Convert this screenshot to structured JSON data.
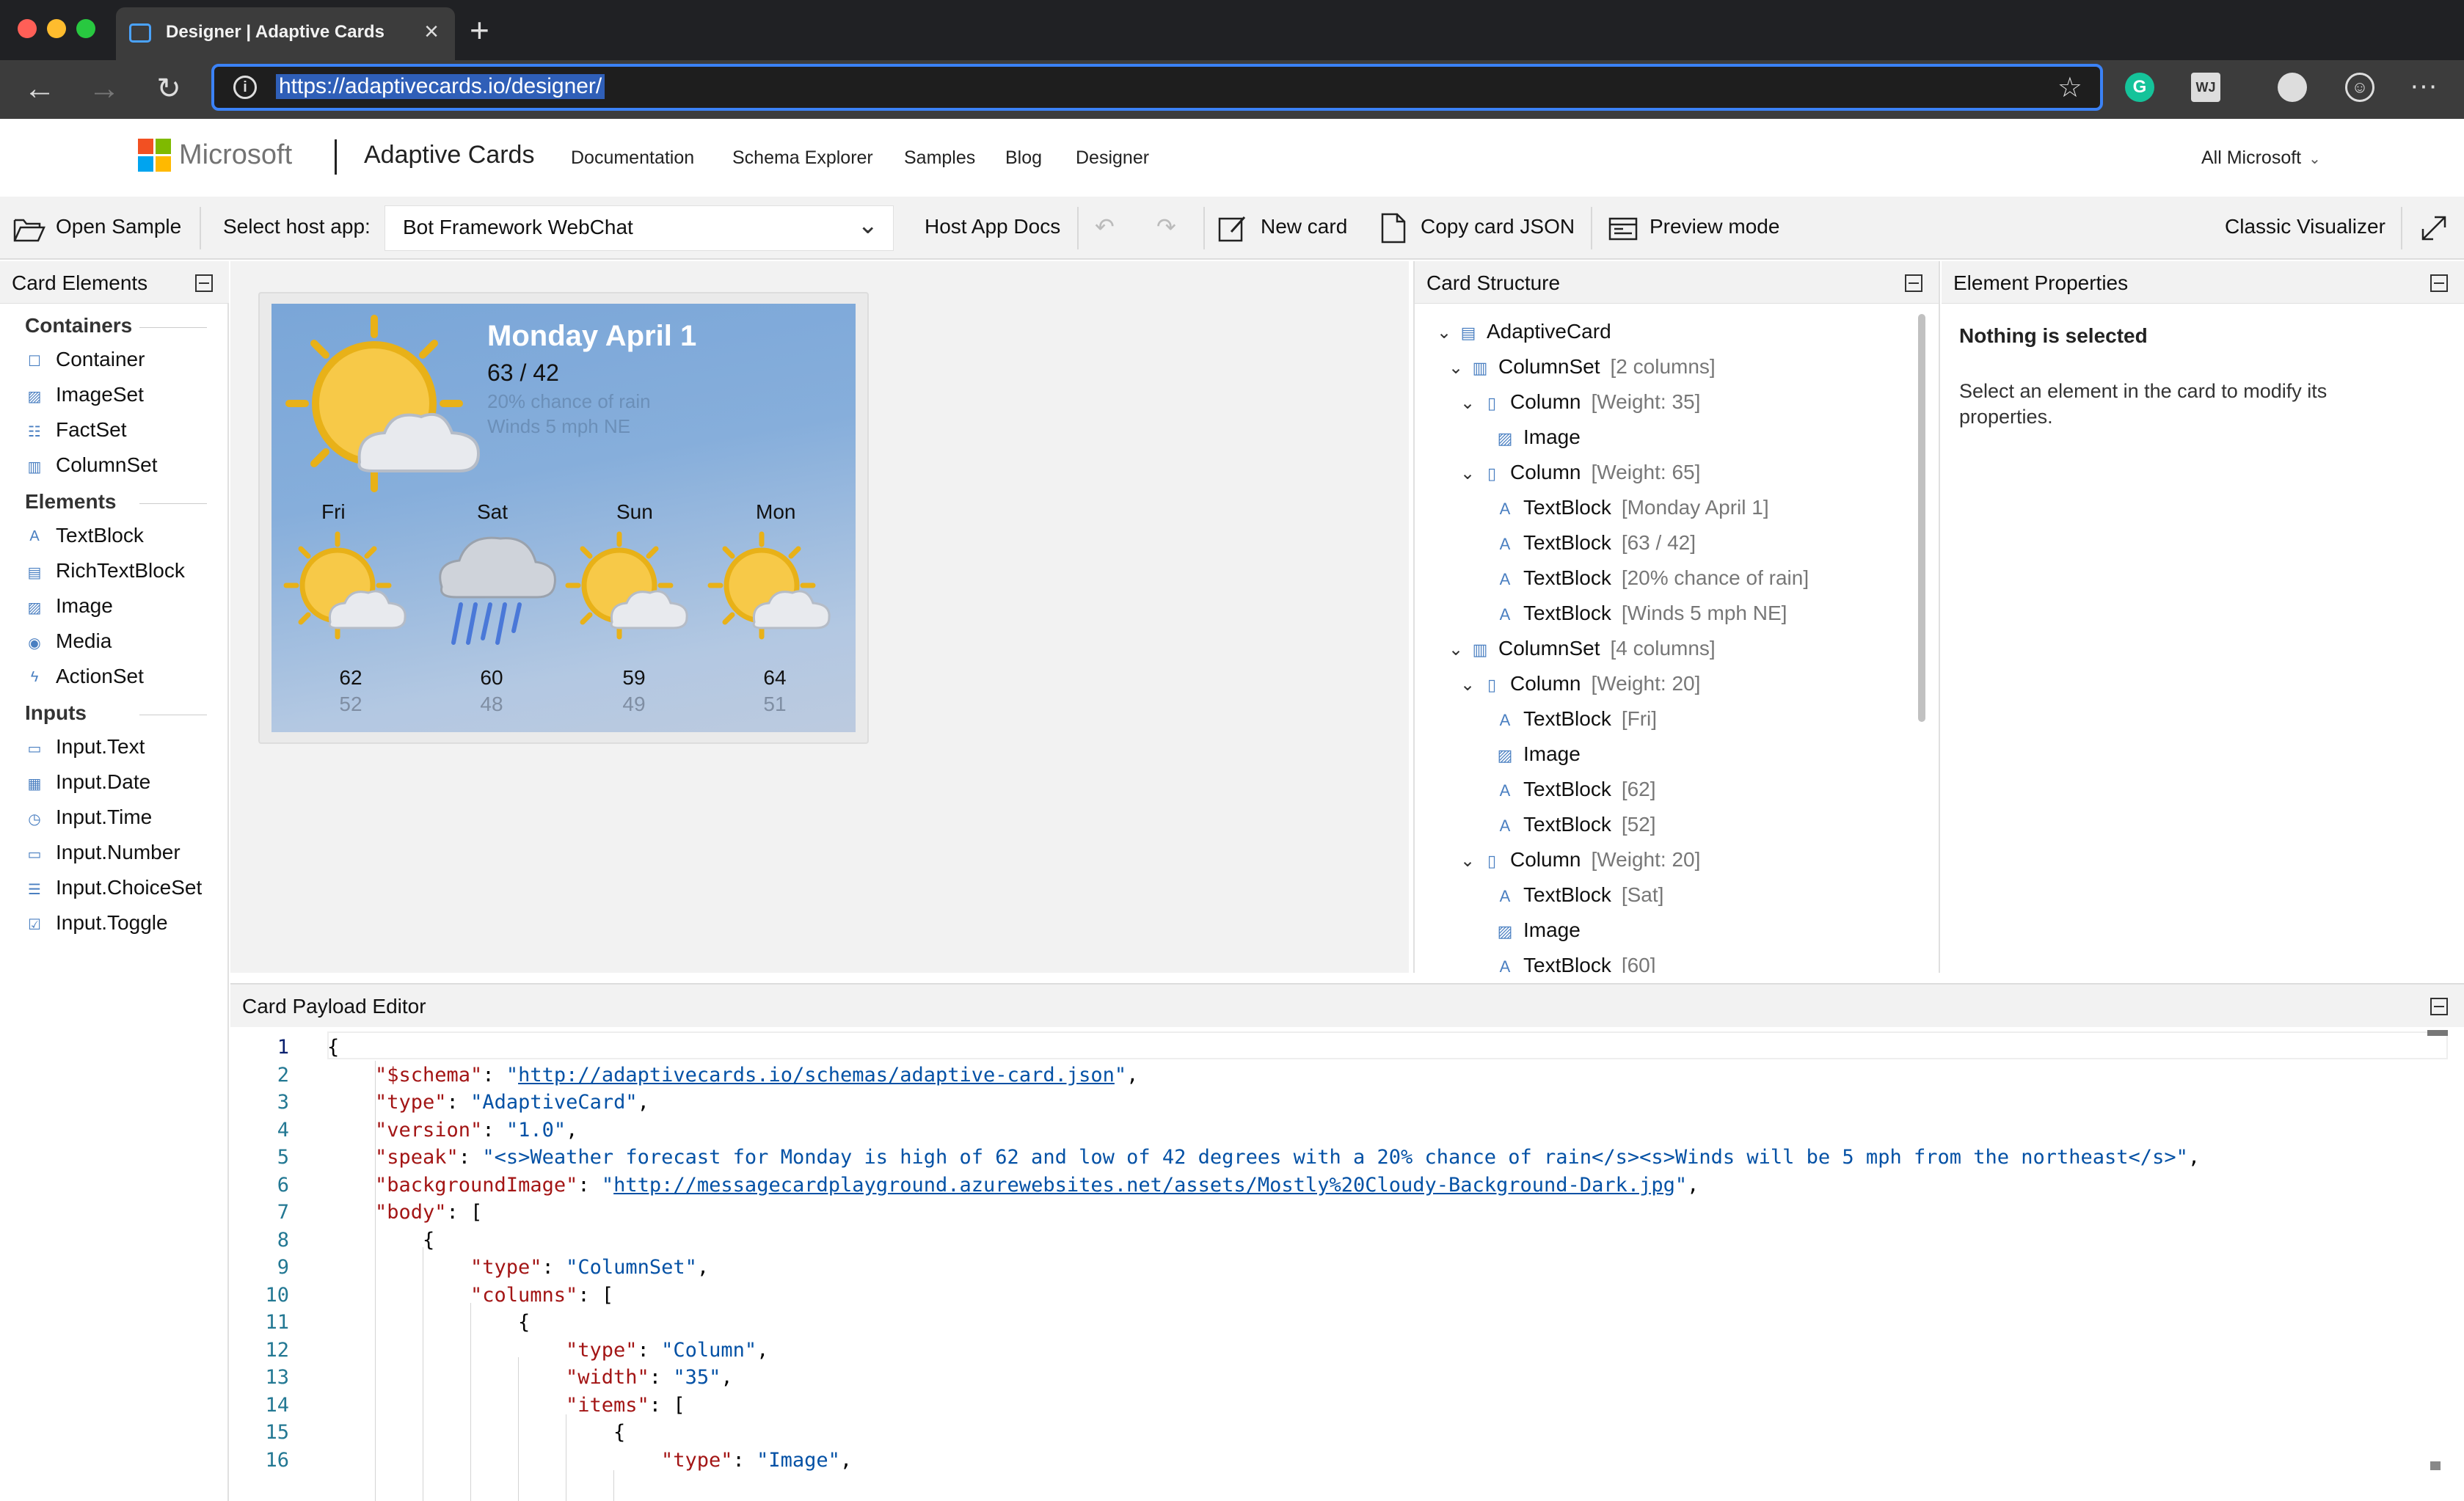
{
  "browser": {
    "tab_title": "Designer | Adaptive Cards",
    "url": "https://adaptivecards.io/designer/",
    "traffic_colors": [
      "#ff5f57",
      "#febc2e",
      "#28c840"
    ]
  },
  "site_header": {
    "ms_label": "Microsoft",
    "brand": "Adaptive Cards",
    "nav": [
      "Documentation",
      "Schema Explorer",
      "Samples",
      "Blog",
      "Designer"
    ],
    "all_microsoft": "All Microsoft"
  },
  "toolbar": {
    "open_sample": "Open Sample",
    "select_host_label": "Select host app:",
    "host_value": "Bot Framework WebChat",
    "host_docs": "Host App Docs",
    "new_card": "New card",
    "copy_json": "Copy card JSON",
    "preview_mode": "Preview mode",
    "classic_visualizer": "Classic Visualizer"
  },
  "card_elements": {
    "title": "Card Elements",
    "categories": [
      {
        "name": "Containers",
        "items": [
          "Container",
          "ImageSet",
          "FactSet",
          "ColumnSet"
        ]
      },
      {
        "name": "Elements",
        "items": [
          "TextBlock",
          "RichTextBlock",
          "Image",
          "Media",
          "ActionSet"
        ]
      },
      {
        "name": "Inputs",
        "items": [
          "Input.Text",
          "Input.Date",
          "Input.Time",
          "Input.Number",
          "Input.ChoiceSet",
          "Input.Toggle"
        ]
      }
    ]
  },
  "weather_card": {
    "title": "Monday April 1",
    "temps": "63 / 42",
    "rain": "20% chance of rain",
    "wind": "Winds 5 mph NE",
    "days": [
      {
        "day": "Fri",
        "high": "62",
        "low": "52"
      },
      {
        "day": "Sat",
        "high": "60",
        "low": "48"
      },
      {
        "day": "Sun",
        "high": "59",
        "low": "49"
      },
      {
        "day": "Mon",
        "high": "64",
        "low": "51"
      }
    ]
  },
  "card_structure": {
    "title": "Card Structure",
    "nodes": [
      {
        "label": "AdaptiveCard",
        "meta": ""
      },
      {
        "label": "ColumnSet",
        "meta": "[2 columns]"
      },
      {
        "label": "Column",
        "meta": "[Weight: 35]"
      },
      {
        "label": "Image",
        "meta": ""
      },
      {
        "label": "Column",
        "meta": "[Weight: 65]"
      },
      {
        "label": "TextBlock",
        "meta": "[Monday April 1]"
      },
      {
        "label": "TextBlock",
        "meta": "[63 / 42]"
      },
      {
        "label": "TextBlock",
        "meta": "[20% chance of rain]"
      },
      {
        "label": "TextBlock",
        "meta": "[Winds 5 mph NE]"
      },
      {
        "label": "ColumnSet",
        "meta": "[4 columns]"
      },
      {
        "label": "Column",
        "meta": "[Weight: 20]"
      },
      {
        "label": "TextBlock",
        "meta": "[Fri]"
      },
      {
        "label": "Image",
        "meta": ""
      },
      {
        "label": "TextBlock",
        "meta": "[62]"
      },
      {
        "label": "TextBlock",
        "meta": "[52]"
      },
      {
        "label": "Column",
        "meta": "[Weight: 20]"
      },
      {
        "label": "TextBlock",
        "meta": "[Sat]"
      },
      {
        "label": "Image",
        "meta": ""
      },
      {
        "label": "TextBlock",
        "meta": "[60]"
      }
    ]
  },
  "element_properties": {
    "title": "Element Properties",
    "heading": "Nothing is selected",
    "description": "Select an element in the card to modify its properties."
  },
  "editor": {
    "title": "Card Payload Editor",
    "lines": [
      "{",
      "\"$schema\": \"http://adaptivecards.io/schemas/adaptive-card.json\",",
      "\"type\": \"AdaptiveCard\",",
      "\"version\": \"1.0\",",
      "\"speak\": \"<s>Weather forecast for Monday is high of 62 and low of 42 degrees with a 20% chance of rain</s><s>Winds will be 5 mph from the northeast</s>\",",
      "\"backgroundImage\": \"http://messagecardplayground.azurewebsites.net/assets/Mostly%20Cloudy-Background-Dark.jpg\",",
      "\"body\": [",
      "{",
      "\"type\": \"ColumnSet\",",
      "\"columns\": [",
      "{",
      "\"type\": \"Column\",",
      "\"width\": \"35\",",
      "\"items\": [",
      "{",
      "\"type\": \"Image\","
    ]
  }
}
